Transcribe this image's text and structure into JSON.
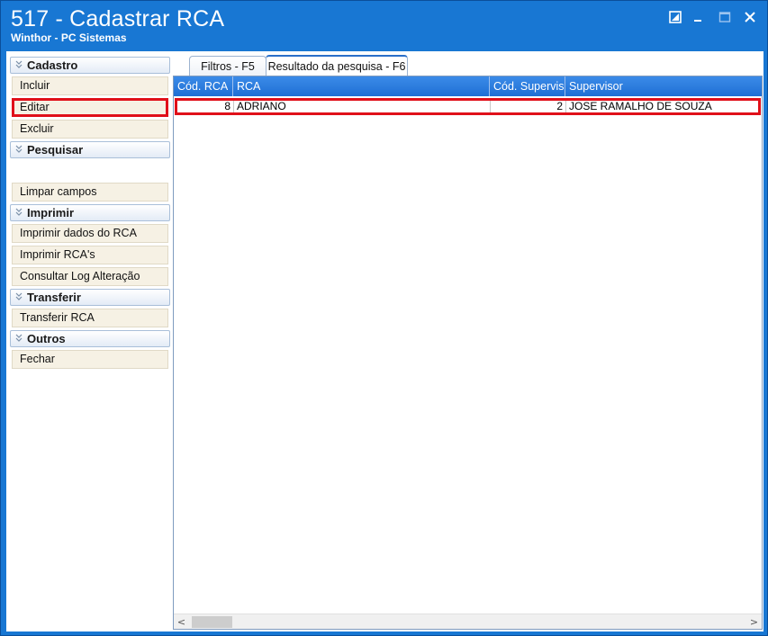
{
  "window": {
    "title": "517 - Cadastrar RCA",
    "subtitle": "Winthor - PC Sistemas",
    "controls": [
      "restore-small-icon",
      "minimize-icon",
      "maximize-icon",
      "close-icon"
    ]
  },
  "sidebar": {
    "groups": [
      {
        "label": "Cadastro",
        "items": [
          "Incluir",
          "Editar",
          "Excluir"
        ]
      },
      {
        "label": "Pesquisar",
        "items": [
          "Limpar campos"
        ]
      },
      {
        "label": "Imprimir",
        "items": [
          "Imprimir dados do RCA",
          "Imprimir RCA's",
          "Consultar Log Alteração"
        ]
      },
      {
        "label": "Transferir",
        "items": [
          "Transferir RCA"
        ]
      },
      {
        "label": "Outros",
        "items": [
          "Fechar"
        ]
      }
    ]
  },
  "tabs": [
    {
      "label": "Filtros - F5",
      "active": false
    },
    {
      "label": "Resultado da pesquisa - F6",
      "active": true
    }
  ],
  "grid": {
    "columns": [
      "Cód. RCA",
      "RCA",
      "Cód. Supervis",
      "Supervisor"
    ],
    "rows": [
      [
        "8",
        "ADRIANO",
        "2",
        "JOSE RAMALHO DE SOUZA"
      ]
    ]
  },
  "scrollbar": {
    "left_arrow": "<",
    "right_arrow": ">"
  },
  "colors": {
    "titlebar": "#1877d3",
    "grid_header": "#1f6fd4",
    "highlight": "#e0101a",
    "item_bg": "#f6f1e4"
  }
}
